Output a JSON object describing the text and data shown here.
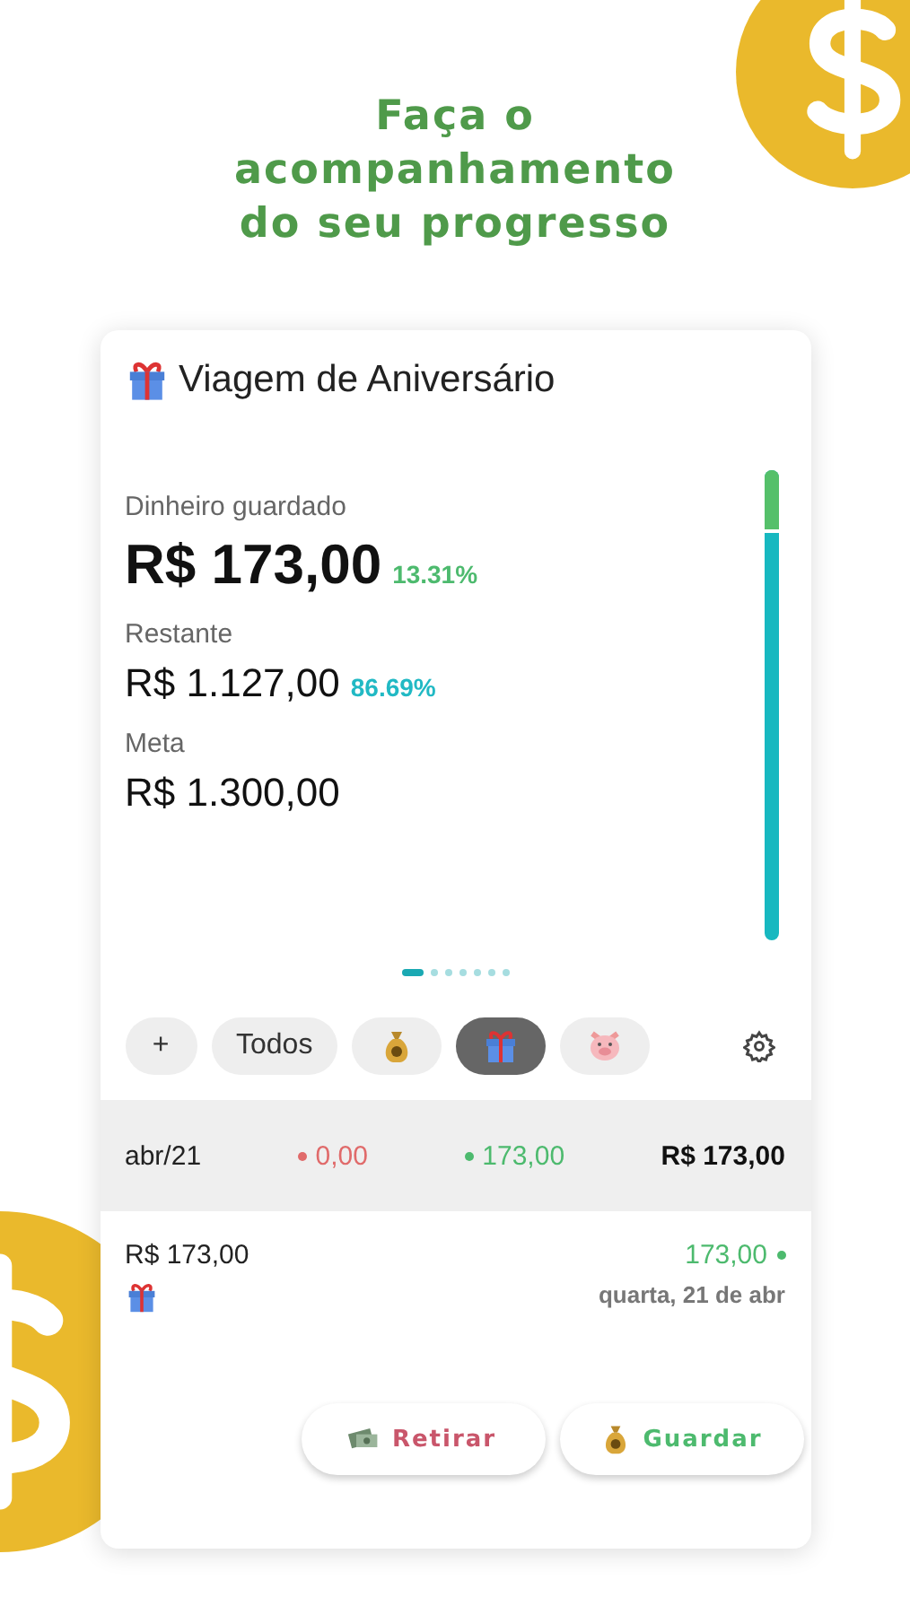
{
  "headline": "Faça o acompanhamento do seu progresso",
  "goal": {
    "title": "Viagem de Aniversário",
    "saved": {
      "label": "Dinheiro guardado",
      "amount": "R$ 173,00",
      "percent": "13.31%"
    },
    "remaining": {
      "label": "Restante",
      "amount": "R$ 1.127,00",
      "percent": "86.69%"
    },
    "target": {
      "label": "Meta",
      "amount": "R$ 1.300,00"
    },
    "progress": {
      "level": 0.1331
    }
  },
  "pager": [
    {
      "selected": true
    },
    {
      "selected": false
    },
    {
      "selected": false
    },
    {
      "selected": false
    },
    {
      "selected": false
    },
    {
      "selected": false
    },
    {
      "selected": false
    }
  ],
  "filters": [
    {
      "kind": "text",
      "label": "+",
      "selected": false
    },
    {
      "kind": "text",
      "label": "Todos",
      "selected": false
    },
    {
      "kind": "moneybag",
      "selected": false
    },
    {
      "kind": "gift",
      "selected": true
    },
    {
      "kind": "pig",
      "selected": false
    }
  ],
  "month_summary": {
    "month": "abr/21",
    "withdrawn": "0,00",
    "saved": "173,00",
    "total": "R$ 173,00"
  },
  "entries": [
    {
      "amount": "R$ 173,00",
      "value": "173,00",
      "date": "quarta, 21 de abr"
    }
  ],
  "actions": [
    {
      "kind": "withdraw",
      "label": "Retirar"
    },
    {
      "kind": "save",
      "label": "Guardar"
    }
  ]
}
